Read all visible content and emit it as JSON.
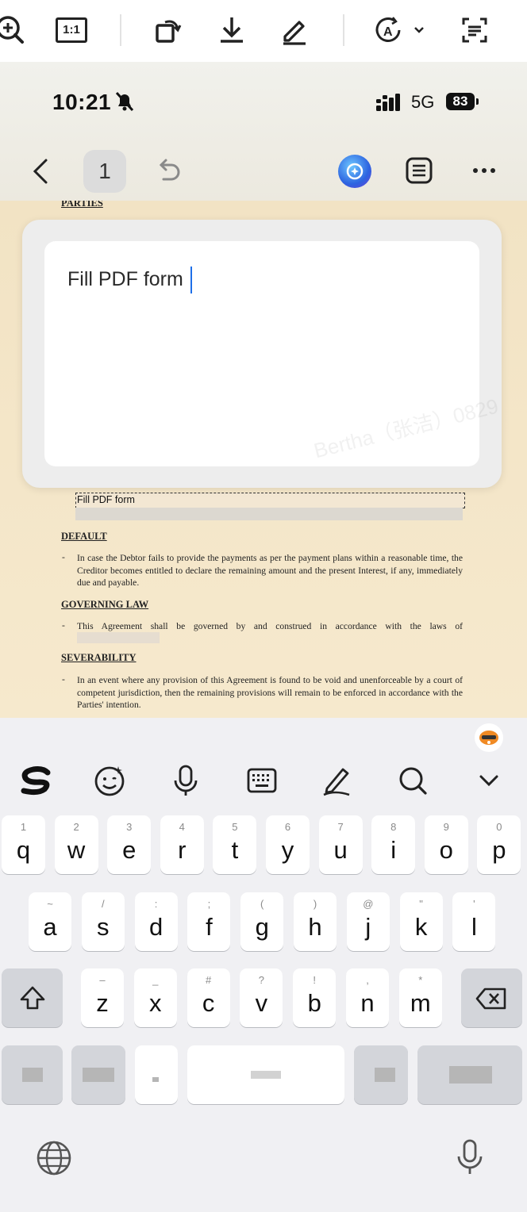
{
  "viewer_toolbar": {
    "icons": [
      "zoom-in-icon",
      "actual-size-icon",
      "rotate-icon",
      "download-icon",
      "edit-icon",
      "auto-text-icon",
      "scan-icon"
    ],
    "actual_size_label": "1:1"
  },
  "status_bar": {
    "time": "10:21",
    "network": "5G",
    "battery": "83"
  },
  "app_header": {
    "page_number": "1"
  },
  "dialog": {
    "input_value": "Fill PDF form"
  },
  "document": {
    "top_heading": "PARTIES",
    "form_field_value": "Fill PDF form",
    "sections": [
      {
        "heading": "DEFAULT",
        "text": "In case the Debtor fails to provide the payments as per the payment plans within a reasonable time, the Creditor becomes entitled to declare the remaining amount and the present Interest, if any, immediately due and payable."
      },
      {
        "heading": "GOVERNING LAW",
        "text": "This Agreement shall be governed by and construed in accordance with the laws of"
      },
      {
        "heading": "SEVERABILITY",
        "text": "In an event where any provision of this Agreement is found to be void and unenforceable by a court of competent jurisdiction, then the remaining provisions will remain to be enforced in accordance with the Parties' intention."
      }
    ]
  },
  "watermark": "Bertha（张洁）0829",
  "keyboard": {
    "row1": [
      {
        "main": "q",
        "sub": "1"
      },
      {
        "main": "w",
        "sub": "2"
      },
      {
        "main": "e",
        "sub": "3"
      },
      {
        "main": "r",
        "sub": "4"
      },
      {
        "main": "t",
        "sub": "5"
      },
      {
        "main": "y",
        "sub": "6"
      },
      {
        "main": "u",
        "sub": "7"
      },
      {
        "main": "i",
        "sub": "8"
      },
      {
        "main": "o",
        "sub": "9"
      },
      {
        "main": "p",
        "sub": "0"
      }
    ],
    "row2": [
      {
        "main": "a",
        "sub": "~"
      },
      {
        "main": "s",
        "sub": "/"
      },
      {
        "main": "d",
        "sub": ":"
      },
      {
        "main": "f",
        "sub": ";"
      },
      {
        "main": "g",
        "sub": "("
      },
      {
        "main": "h",
        "sub": ")"
      },
      {
        "main": "j",
        "sub": "@"
      },
      {
        "main": "k",
        "sub": "\""
      },
      {
        "main": "l",
        "sub": "'"
      }
    ],
    "row3": [
      {
        "main": "z",
        "sub": "–"
      },
      {
        "main": "x",
        "sub": "_"
      },
      {
        "main": "c",
        "sub": "#"
      },
      {
        "main": "v",
        "sub": "?"
      },
      {
        "main": "b",
        "sub": "!"
      },
      {
        "main": "n",
        "sub": ","
      },
      {
        "main": "m",
        "sub": "*"
      }
    ],
    "colors": {
      "accent": "#1e6fe8",
      "key": "#ffffff",
      "special_key": "#d3d5da"
    }
  }
}
